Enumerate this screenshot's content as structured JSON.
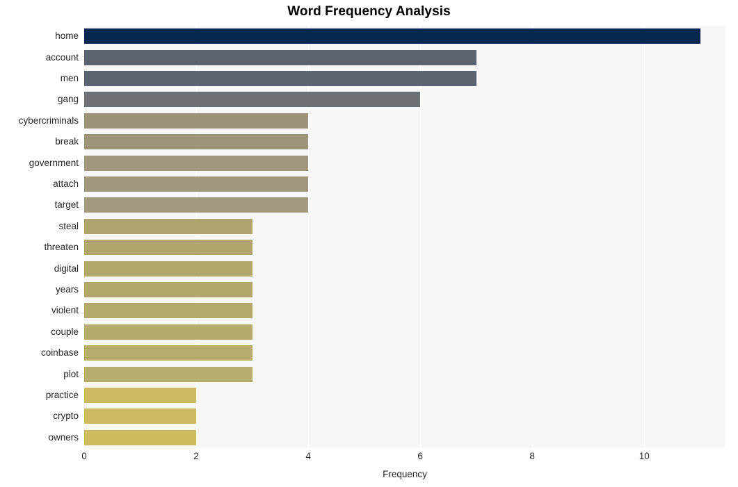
{
  "chart_data": {
    "type": "bar",
    "orientation": "horizontal",
    "title": "Word Frequency Analysis",
    "xlabel": "Frequency",
    "ylabel": "",
    "xlim": [
      0,
      11.45
    ],
    "ylim": null,
    "grid": true,
    "legend": null,
    "xticks": [
      "0",
      "2",
      "4",
      "6",
      "8",
      "10"
    ],
    "xtick_values": [
      0,
      2,
      4,
      6,
      8,
      10
    ],
    "categories": [
      "home",
      "account",
      "men",
      "gang",
      "cybercriminals",
      "break",
      "government",
      "attach",
      "target",
      "steal",
      "threaten",
      "digital",
      "years",
      "violent",
      "couple",
      "coinbase",
      "plot",
      "practice",
      "crypto",
      "owners"
    ],
    "values": [
      11,
      7,
      7,
      6,
      4,
      4,
      4,
      4,
      4,
      3,
      3,
      3,
      3,
      3,
      3,
      3,
      3,
      2,
      2,
      2
    ],
    "bar_colors": [
      "#04264f",
      "#5c6270",
      "#5e6371",
      "#6e7175",
      "#9a9377",
      "#9d957a",
      "#9e977b",
      "#9f987c",
      "#a09a7f",
      "#aea46e",
      "#b0a66d",
      "#b1a76d",
      "#b2a86d",
      "#b3a96c",
      "#b5ab6c",
      "#b6ac6b",
      "#b7ae6b",
      "#cbba61",
      "#ccbb60",
      "#cdbc5f"
    ],
    "plot_background": "#f7f7f7",
    "gridline_color": "#ffffff",
    "page_background": "#ffffff",
    "text_color": "#262626"
  }
}
